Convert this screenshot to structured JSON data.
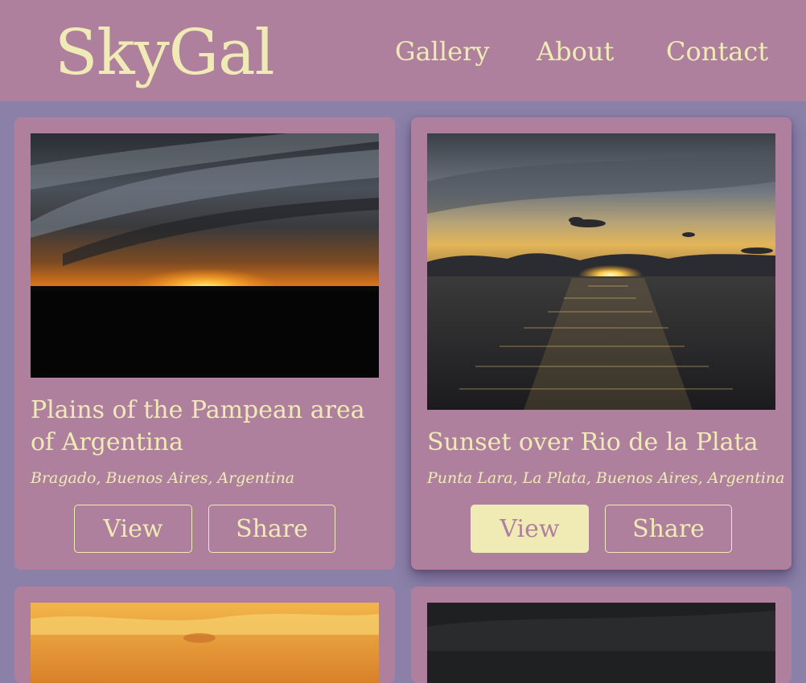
{
  "brand": {
    "name": "SkyGal"
  },
  "nav": {
    "items": [
      {
        "label": "Gallery"
      },
      {
        "label": "About"
      },
      {
        "label": "Contact"
      }
    ]
  },
  "gallery": {
    "cards": [
      {
        "title": "Plains of the Pampean area of Argentina",
        "location": "Bragado, Buenos Aires, Argentina",
        "view_label": "View",
        "share_label": "Share"
      },
      {
        "title": "Sunset over Rio de la Plata",
        "location": "Punta Lara, La Plata, Buenos Aires, Argentina",
        "view_label": "View",
        "share_label": "Share"
      }
    ]
  },
  "colors": {
    "header_bg": "#ae809e",
    "page_bg": "#8a80a8",
    "accent_text": "#f0ebb5"
  }
}
